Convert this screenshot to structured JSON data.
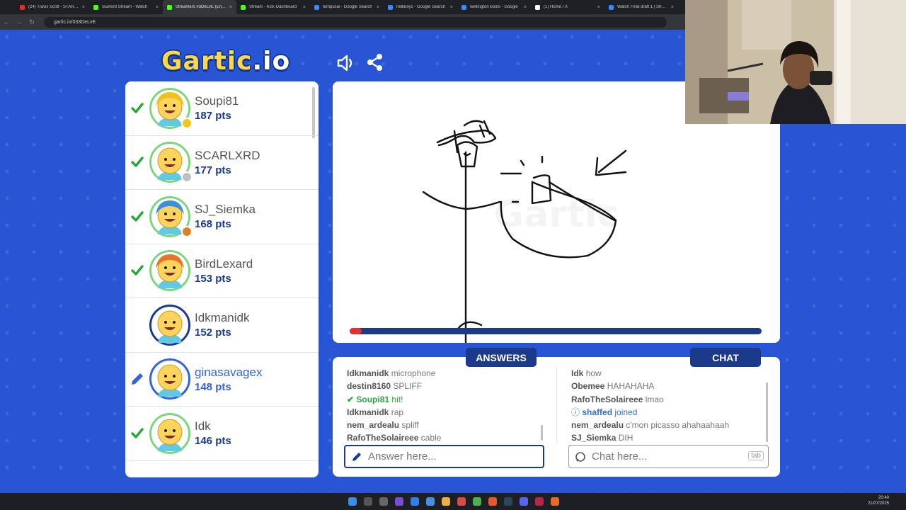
{
  "browser": {
    "tabs": [
      {
        "title": "(24) Travis Scott - STARGAZING",
        "color": "#e52d27",
        "active": false
      },
      {
        "title": "scarlxrd Stream - Watch",
        "color": "#53fc18",
        "active": false
      },
      {
        "title": "Streamers #3DeLvE (English)",
        "color": "#53fc18",
        "active": true
      },
      {
        "title": "Stream - Kick Dashboard",
        "color": "#53fc18",
        "active": false
      },
      {
        "title": "tempusai - Google Search",
        "color": "#4285f4",
        "active": false
      },
      {
        "title": "nelkboys - Google Search",
        "color": "#4285f4",
        "active": false
      },
      {
        "title": "wellington boots - Google",
        "color": "#4285f4",
        "active": false
      },
      {
        "title": "(1) Home / X",
        "color": "#ffffff",
        "active": false
      },
      {
        "title": "Watch Final draft 1 | Stream",
        "color": "#3a86ff",
        "active": false
      }
    ],
    "url": "gartic.io/033DeLvE"
  },
  "header": {
    "logo_main": "Gartic",
    "logo_suffix": ".io"
  },
  "players": [
    {
      "name": "Soupi81",
      "pts": "187 pts",
      "hit": true,
      "drawing": false,
      "medal": "#f5c518",
      "skin": "#ffd45c",
      "hair": "#f0c020",
      "ring": "#7dd67d"
    },
    {
      "name": "SCARLXRD",
      "pts": "177 pts",
      "hit": true,
      "drawing": false,
      "medal": "#c0c0c0",
      "skin": "#ffd45c",
      "hair": "",
      "ring": "#7dd67d"
    },
    {
      "name": "SJ_Siemka",
      "pts": "168 pts",
      "hit": true,
      "drawing": false,
      "medal": "#d9822b",
      "skin": "#ffd45c",
      "hair": "#3a8fe0",
      "ring": "#7dd67d"
    },
    {
      "name": "BirdLexard",
      "pts": "153 pts",
      "hit": true,
      "drawing": false,
      "medal": "",
      "skin": "#ffd45c",
      "hair": "#e8742a",
      "ring": "#7dd67d"
    },
    {
      "name": "Idkmanidk",
      "pts": "152 pts",
      "hit": false,
      "drawing": false,
      "medal": "",
      "skin": "#ffd45c",
      "hair": "",
      "ring": "#1b3a8a"
    },
    {
      "name": "ginasavagex",
      "pts": "148 pts",
      "hit": false,
      "drawing": true,
      "medal": "",
      "skin": "#ffd45c",
      "hair": "",
      "ring": "#3562d8"
    },
    {
      "name": "Idk",
      "pts": "146 pts",
      "hit": true,
      "drawing": false,
      "medal": "",
      "skin": "#ffd45c",
      "hair": "",
      "ring": "#7dd67d"
    }
  ],
  "game": {
    "timer_progress": 0.03
  },
  "answers": {
    "tab_label": "ANSWERS",
    "messages": [
      {
        "user": "Idkmanidk",
        "text": "microphone",
        "kind": "normal"
      },
      {
        "user": "destin8160",
        "text": "SPLIFF",
        "kind": "normal"
      },
      {
        "user": "Soupi81",
        "text": "hit!",
        "kind": "hit"
      },
      {
        "user": "Idkmanidk",
        "text": "rap",
        "kind": "normal"
      },
      {
        "user": "nem_ardealu",
        "text": "spliff",
        "kind": "normal"
      },
      {
        "user": "RafoTheSolaireee",
        "text": "cable",
        "kind": "normal"
      }
    ],
    "placeholder": "Answer here..."
  },
  "chat": {
    "tab_label": "CHAT",
    "messages": [
      {
        "user": "Idk",
        "text": "how",
        "kind": "normal"
      },
      {
        "user": "Obemee",
        "text": "HAHAHAHA",
        "kind": "normal"
      },
      {
        "user": "RafoTheSolaireee",
        "text": "lmao",
        "kind": "normal"
      },
      {
        "user": "shaffed",
        "text": "joined",
        "kind": "joined"
      },
      {
        "user": "nem_ardealu",
        "text": "c'mon picasso ahahaahaah",
        "kind": "normal"
      },
      {
        "user": "SJ_Siemka",
        "text": "DIH",
        "kind": "normal"
      }
    ],
    "placeholder": "Chat here...",
    "tab_hint": "tab"
  },
  "taskbar": {
    "time": "20:40",
    "date": "21/07/2025"
  }
}
